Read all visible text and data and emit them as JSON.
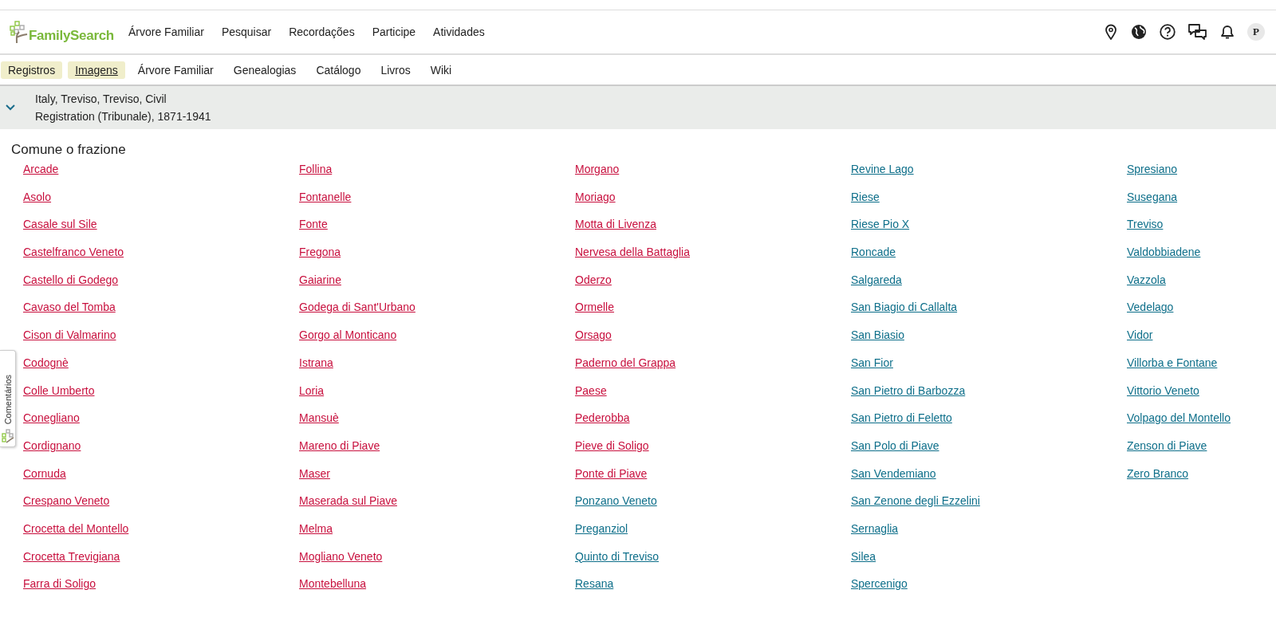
{
  "header": {
    "logo": "FamilySearch",
    "nav": [
      "Árvore Familiar",
      "Pesquisar",
      "Recordações",
      "Participe",
      "Atividades"
    ],
    "avatar": "P"
  },
  "subnav": [
    {
      "label": "Registros",
      "highlighted": true,
      "selected": false
    },
    {
      "label": "Imagens",
      "highlighted": true,
      "selected": true
    },
    {
      "label": "Árvore Familiar",
      "highlighted": false,
      "selected": false
    },
    {
      "label": "Genealogias",
      "highlighted": false,
      "selected": false
    },
    {
      "label": "Catálogo",
      "highlighted": false,
      "selected": false
    },
    {
      "label": "Livros",
      "highlighted": false,
      "selected": false
    },
    {
      "label": "Wiki",
      "highlighted": false,
      "selected": false
    }
  ],
  "collection": {
    "title_line_1": "Italy, Treviso, Treviso, Civil",
    "title_line_2": "Registration (Tribunale), 1871-1941",
    "expanded": false
  },
  "heading": "Comune o frazione",
  "places": [
    {
      "label": "Arcade",
      "visited": true
    },
    {
      "label": "Asolo",
      "visited": true
    },
    {
      "label": "Casale sul Sile",
      "visited": true
    },
    {
      "label": "Castelfranco Veneto",
      "visited": true
    },
    {
      "label": "Castello di Godego",
      "visited": true
    },
    {
      "label": "Cavaso del Tomba",
      "visited": true
    },
    {
      "label": "Cison di Valmarino",
      "visited": true
    },
    {
      "label": "Codognè",
      "visited": true
    },
    {
      "label": "Colle Umberto",
      "visited": true
    },
    {
      "label": "Conegliano",
      "visited": true
    },
    {
      "label": "Cordignano",
      "visited": true
    },
    {
      "label": "Cornuda",
      "visited": true
    },
    {
      "label": "Crespano Veneto",
      "visited": true
    },
    {
      "label": "Crocetta del Montello",
      "visited": true
    },
    {
      "label": "Crocetta Trevigiana",
      "visited": true
    },
    {
      "label": "Farra di Soligo",
      "visited": true
    },
    {
      "label": "Follina",
      "visited": true
    },
    {
      "label": "Fontanelle",
      "visited": true
    },
    {
      "label": "Fonte",
      "visited": true
    },
    {
      "label": "Fregona",
      "visited": true
    },
    {
      "label": "Gaiarine",
      "visited": true
    },
    {
      "label": "Godega di Sant'Urbano",
      "visited": true
    },
    {
      "label": "Gorgo al Monticano",
      "visited": true
    },
    {
      "label": "Istrana",
      "visited": true
    },
    {
      "label": "Loria",
      "visited": true
    },
    {
      "label": "Mansuè",
      "visited": true
    },
    {
      "label": "Mareno di Piave",
      "visited": true
    },
    {
      "label": "Maser",
      "visited": true
    },
    {
      "label": "Maserada sul Piave",
      "visited": true
    },
    {
      "label": "Melma",
      "visited": true
    },
    {
      "label": "Mogliano Veneto",
      "visited": true
    },
    {
      "label": "Montebelluna",
      "visited": true
    },
    {
      "label": "Morgano",
      "visited": true
    },
    {
      "label": "Moriago",
      "visited": true
    },
    {
      "label": "Motta di Livenza",
      "visited": true
    },
    {
      "label": "Nervesa della Battaglia",
      "visited": true
    },
    {
      "label": "Oderzo",
      "visited": true
    },
    {
      "label": "Ormelle",
      "visited": true
    },
    {
      "label": "Orsago",
      "visited": true
    },
    {
      "label": "Paderno del Grappa",
      "visited": true
    },
    {
      "label": "Paese",
      "visited": true
    },
    {
      "label": "Pederobba",
      "visited": true
    },
    {
      "label": "Pieve di Soligo",
      "visited": true
    },
    {
      "label": "Ponte di Piave",
      "visited": true
    },
    {
      "label": "Ponzano Veneto",
      "visited": false
    },
    {
      "label": "Preganziol",
      "visited": false
    },
    {
      "label": "Quinto di Treviso",
      "visited": false
    },
    {
      "label": "Resana",
      "visited": false
    },
    {
      "label": "Revine Lago",
      "visited": false
    },
    {
      "label": "Riese",
      "visited": false
    },
    {
      "label": "Riese Pio X",
      "visited": false
    },
    {
      "label": "Roncade",
      "visited": false
    },
    {
      "label": "Salgareda",
      "visited": false
    },
    {
      "label": "San Biagio di Callalta",
      "visited": false
    },
    {
      "label": "San Biasio",
      "visited": false
    },
    {
      "label": "San Fior",
      "visited": false
    },
    {
      "label": "San Pietro di Barbozza",
      "visited": false
    },
    {
      "label": "San Pietro di Feletto",
      "visited": false
    },
    {
      "label": "San Polo di Piave",
      "visited": false
    },
    {
      "label": "San Vendemiano",
      "visited": false
    },
    {
      "label": "San Zenone degli Ezzelini",
      "visited": false
    },
    {
      "label": "Sernaglia",
      "visited": false
    },
    {
      "label": "Silea",
      "visited": false
    },
    {
      "label": "Spercenigo",
      "visited": false
    },
    {
      "label": "Spresiano",
      "visited": false
    },
    {
      "label": "Susegana",
      "visited": false
    },
    {
      "label": "Treviso",
      "visited": false
    },
    {
      "label": "Valdobbiadene",
      "visited": false
    },
    {
      "label": "Vazzola",
      "visited": false
    },
    {
      "label": "Vedelago",
      "visited": false
    },
    {
      "label": "Vidor",
      "visited": false
    },
    {
      "label": "Villorba e Fontane",
      "visited": false
    },
    {
      "label": "Vittorio Veneto",
      "visited": false
    },
    {
      "label": "Volpago del Montello",
      "visited": false
    },
    {
      "label": "Zenson di Piave",
      "visited": false
    },
    {
      "label": "Zero Branco",
      "visited": false
    }
  ],
  "feedback_tab": "Comentários"
}
